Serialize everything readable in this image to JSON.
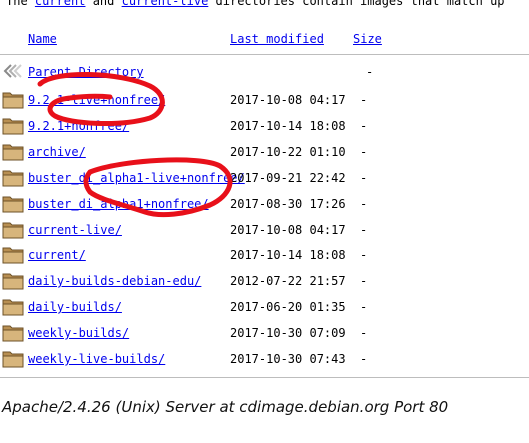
{
  "intro": {
    "prefix": "The ",
    "link1": "current",
    "middle": " and ",
    "link2": "current-live",
    "suffix": " directories contain images that match up"
  },
  "columns": {
    "name": "Name",
    "modified": "Last modified",
    "size": "Size"
  },
  "parent": {
    "label": "Parent Directory",
    "size": "-"
  },
  "rows": [
    {
      "name": "9.2.1-live+nonfree/",
      "date": "2017-10-08 04:17",
      "size": "-"
    },
    {
      "name": "9.2.1+nonfree/",
      "date": "2017-10-14 18:08",
      "size": "-"
    },
    {
      "name": "archive/",
      "date": "2017-10-22 01:10",
      "size": "-"
    },
    {
      "name": "buster_di_alpha1-live+nonfree/",
      "date": "2017-09-21 22:42",
      "size": "-"
    },
    {
      "name": "buster_di_alpha1+nonfree/",
      "date": "2017-08-30 17:26",
      "size": "-"
    },
    {
      "name": "current-live/",
      "date": "2017-10-08 04:17",
      "size": "-"
    },
    {
      "name": "current/",
      "date": "2017-10-14 18:08",
      "size": "-"
    },
    {
      "name": "daily-builds-debian-edu/",
      "date": "2012-07-22 21:57",
      "size": "-"
    },
    {
      "name": "daily-builds/",
      "date": "2017-06-20 01:35",
      "size": "-"
    },
    {
      "name": "weekly-builds/",
      "date": "2017-10-30 07:09",
      "size": "-"
    },
    {
      "name": "weekly-live-builds/",
      "date": "2017-10-30 07:43",
      "size": "-"
    }
  ],
  "footer": "Apache/2.4.26 (Unix) Server at cdimage.debian.org Port 80",
  "colors": {
    "link": "#0000ee",
    "folder": "#c9a66b",
    "annotation": "#e8101a",
    "rule": "#bdbdbd"
  }
}
